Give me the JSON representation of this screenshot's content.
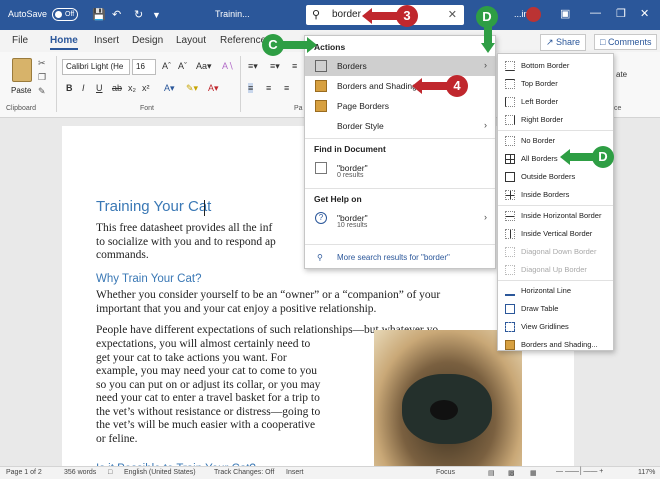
{
  "titlebar": {
    "autosave_label": "AutoSave",
    "autosave_state": "Off",
    "title": "Trainin...",
    "user_label": "...ines"
  },
  "search": {
    "value": "border"
  },
  "tabs": [
    "File",
    "Home",
    "Insert",
    "Design",
    "Layout",
    "Reference"
  ],
  "share_label": "Share",
  "comments_label": "Comments",
  "ribbon": {
    "paste_label": "Paste",
    "clipboard_group": "Clipboard",
    "font_group": "Font",
    "font_name": "Calibri Light (He",
    "font_size": "16",
    "para_group": "Pa",
    "styles_group_tail": "ce",
    "replace_tail": "ate"
  },
  "dropdown": {
    "actions_header": "Actions",
    "actions": [
      {
        "label": "Borders",
        "has_submenu": true,
        "hover": true
      },
      {
        "label": "Borders and Shading",
        "has_submenu": false
      },
      {
        "label": "Page Borders",
        "has_submenu": false
      },
      {
        "label": "Border Style",
        "has_submenu": true
      }
    ],
    "find_header": "Find in Document",
    "find_item": {
      "label": "\"border\"",
      "sub": "0 results"
    },
    "help_header": "Get Help on",
    "help_item": {
      "label": "\"border\"",
      "sub": "10 results"
    },
    "more": "More search results for \"border\""
  },
  "submenu": {
    "items": [
      {
        "label": "Bottom Border",
        "enabled": true
      },
      {
        "label": "Top Border",
        "enabled": true
      },
      {
        "label": "Left Border",
        "enabled": true
      },
      {
        "label": "Right Border",
        "enabled": true
      },
      {
        "label": "No Border",
        "enabled": true
      },
      {
        "label": "All Borders",
        "enabled": true
      },
      {
        "label": "Outside Borders",
        "enabled": true
      },
      {
        "label": "Inside Borders",
        "enabled": true
      },
      {
        "label": "Inside Horizontal Border",
        "enabled": true
      },
      {
        "label": "Inside Vertical Border",
        "enabled": true
      },
      {
        "label": "Diagonal Down Border",
        "enabled": false
      },
      {
        "label": "Diagonal Up Border",
        "enabled": false
      },
      {
        "label": "Horizontal Line",
        "enabled": true
      },
      {
        "label": "Draw Table",
        "enabled": true
      },
      {
        "label": "View Gridlines",
        "enabled": true
      },
      {
        "label": "Borders and Shading...",
        "enabled": true
      }
    ]
  },
  "document": {
    "title": "Training Your Cat",
    "intro": "This free datasheet provides all the inf\nto socialize with you and to respond ap\ncommands.",
    "h2_why": "Why Train Your Cat?",
    "p_why": "Whether you consider yourself to be an “owner” or a “companion” of your\nimportant that you and your cat enjoy a positive relationship.",
    "p_people_line1": "People have different expectations of such relationships—but whatever yo",
    "p_people_rest": "expectations, you will almost certainly need to\nget your cat to take actions you want. For\nexample, you may need your cat to come to you\nso you can put on or adjust its collar, or you may\nneed your cat to enter a travel basket for a trip to\nthe vet’s without resistance or distress—going to\nthe vet’s will be much easier with a cooperative\nor feline.",
    "h2_possible": "Is it Possible to Train Your Cat?"
  },
  "statusbar": {
    "page": "Page 1 of 2",
    "words": "356 words",
    "language": "English (United States)",
    "track": "Track Changes: Off",
    "insert": "Insert",
    "focus": "Focus",
    "zoom": "117%"
  },
  "callouts": {
    "step3": "3",
    "step4": "4",
    "stepC": "C",
    "stepD": "D"
  },
  "colors": {
    "title_bar": "#2b579a",
    "heading": "#3a78b5",
    "callout_red": "#c0272d",
    "callout_green": "#2e9e44"
  }
}
